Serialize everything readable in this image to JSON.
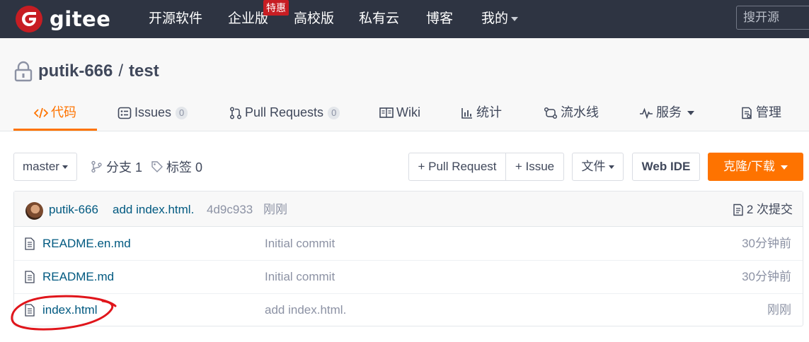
{
  "navbar": {
    "brand": "gitee",
    "items": [
      "开源软件",
      "企业版",
      "高校版",
      "私有云",
      "博客",
      "我的"
    ],
    "badge": "特惠",
    "search_placeholder": "搜开源"
  },
  "repo": {
    "owner": "putik-666",
    "separator": "/",
    "name": "test"
  },
  "tabs": [
    {
      "label": "代码",
      "active": true,
      "icon": "code-icon"
    },
    {
      "label": "Issues",
      "count": "0",
      "icon": "issues-icon"
    },
    {
      "label": "Pull Requests",
      "count": "0",
      "icon": "pull-request-icon"
    },
    {
      "label": "Wiki",
      "icon": "wiki-icon"
    },
    {
      "label": "统计",
      "icon": "stats-icon"
    },
    {
      "label": "流水线",
      "icon": "pipeline-icon"
    },
    {
      "label": "服务",
      "icon": "service-icon"
    },
    {
      "label": "管理",
      "icon": "manage-icon"
    }
  ],
  "toolbar": {
    "branch": "master",
    "branches": "分支 1",
    "tags": "标签 0",
    "pull_request": "+ Pull Request",
    "issue": "+ Issue",
    "file": "文件",
    "web_ide": "Web IDE",
    "clone": "克隆/下载"
  },
  "latest_commit": {
    "author": "putik-666",
    "message": "add index.html.",
    "hash": "4d9c933",
    "time": "刚刚",
    "commits": "2 次提交"
  },
  "files": [
    {
      "name": "README.en.md",
      "message": "Initial commit",
      "time": "30分钟前"
    },
    {
      "name": "README.md",
      "message": "Initial commit",
      "time": "30分钟前"
    },
    {
      "name": "index.html",
      "message": "add index.html.",
      "time": "刚刚"
    }
  ],
  "colors": {
    "navbar_bg": "#2e3442",
    "brand_red": "#c71d23",
    "accent_orange": "#fe7300",
    "link_blue": "#005980",
    "annotation_red": "#e0151b"
  }
}
